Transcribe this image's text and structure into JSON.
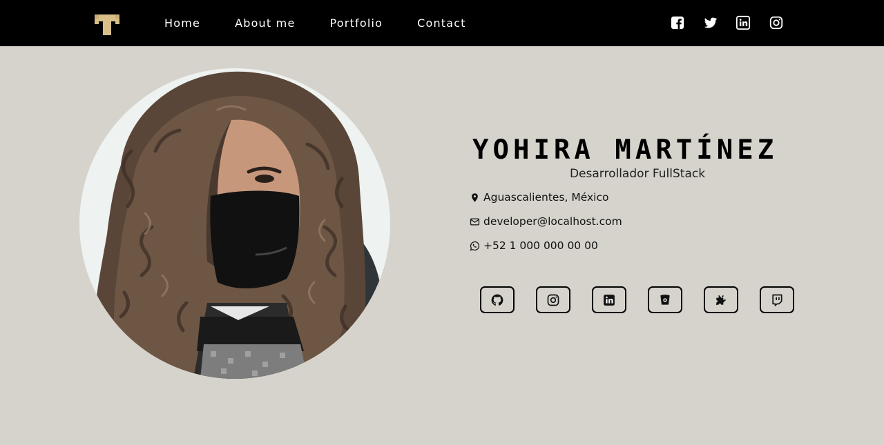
{
  "nav": {
    "logo_icon": "pixel-t-logo",
    "links": [
      "Home",
      "About me",
      "Portfolio",
      "Contact"
    ],
    "social_icons": [
      "facebook-icon",
      "twitter-icon",
      "linkedin-icon",
      "instagram-icon"
    ]
  },
  "profile": {
    "photo_icon": "profile-photo",
    "name": "YOHIRA MARTÍNEZ",
    "role": "Desarrollador FullStack",
    "location": "Aguascalientes, México",
    "email": "developer@localhost.com",
    "phone": "+52 1 000 000 00 00"
  },
  "badges": [
    "github-icon",
    "instagram-icon",
    "linkedin-icon",
    "bucket-icon",
    "puzzle-icon",
    "twitch-icon"
  ],
  "colors": {
    "navbar": "#000000",
    "background": "#d6d3cc",
    "logo": "#d8be88",
    "text": "#111111"
  }
}
